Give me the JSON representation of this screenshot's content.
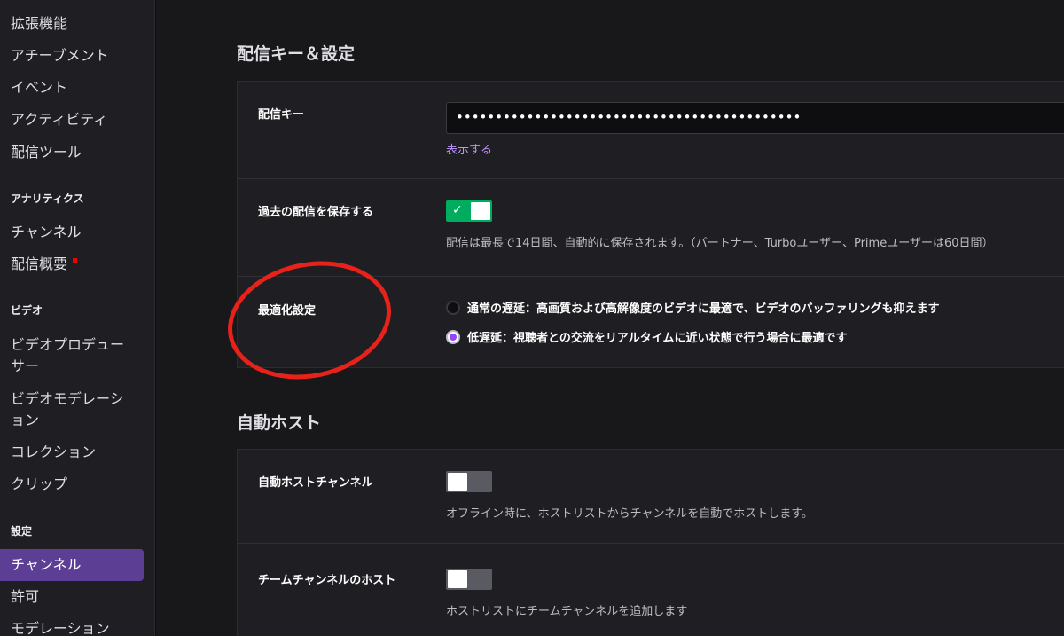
{
  "sidebar": {
    "items_top": [
      "拡張機能",
      "アチーブメント",
      "イベント",
      "アクティビティ",
      "配信ツール"
    ],
    "analytics_heading": "アナリティクス",
    "analytics_items": [
      "チャンネル",
      "配信概要"
    ],
    "video_heading": "ビデオ",
    "video_items": [
      "ビデオプロデュー",
      "サー",
      "ビデオモデレーシ",
      "ョン",
      "コレクション",
      "クリップ"
    ],
    "settings_heading": "設定",
    "settings_items": [
      "チャンネル",
      "許可",
      "モデレーション"
    ]
  },
  "stream_key_section": {
    "title": "配信キー＆設定",
    "stream_key": {
      "label": "配信キー",
      "value": "••••••••••••••••••••••••••••••••••••••••••••",
      "show_link": "表示する"
    },
    "store_past": {
      "label": "過去の配信を保存する",
      "enabled": true,
      "hint": "配信は最長で14日間、自動的に保存されます。（パートナー、Turboユーザー、Primeユーザーは60日間）"
    },
    "optimization": {
      "label": "最適化設定",
      "options": [
        "通常の遅延：高画質および高解像度のビデオに最適で、ビデオのバッファリングも抑えます",
        "低遅延：視聴者との交流をリアルタイムに近い状態で行う場合に最適です"
      ],
      "selected_index": 1
    }
  },
  "auto_host_section": {
    "title": "自動ホスト",
    "auto_host": {
      "label": "自動ホストチャンネル",
      "enabled": false,
      "hint": "オフライン時に、ホストリストからチャンネルを自動でホストします。"
    },
    "team_host": {
      "label": "チームチャンネルのホスト",
      "enabled": false,
      "hint": "ホストリストにチームチャンネルを追加します"
    }
  },
  "colors": {
    "accent": "#9147ff",
    "active_nav": "#5c3e95",
    "toggle_on": "#00ad5e",
    "annotation": "#e8221b"
  }
}
